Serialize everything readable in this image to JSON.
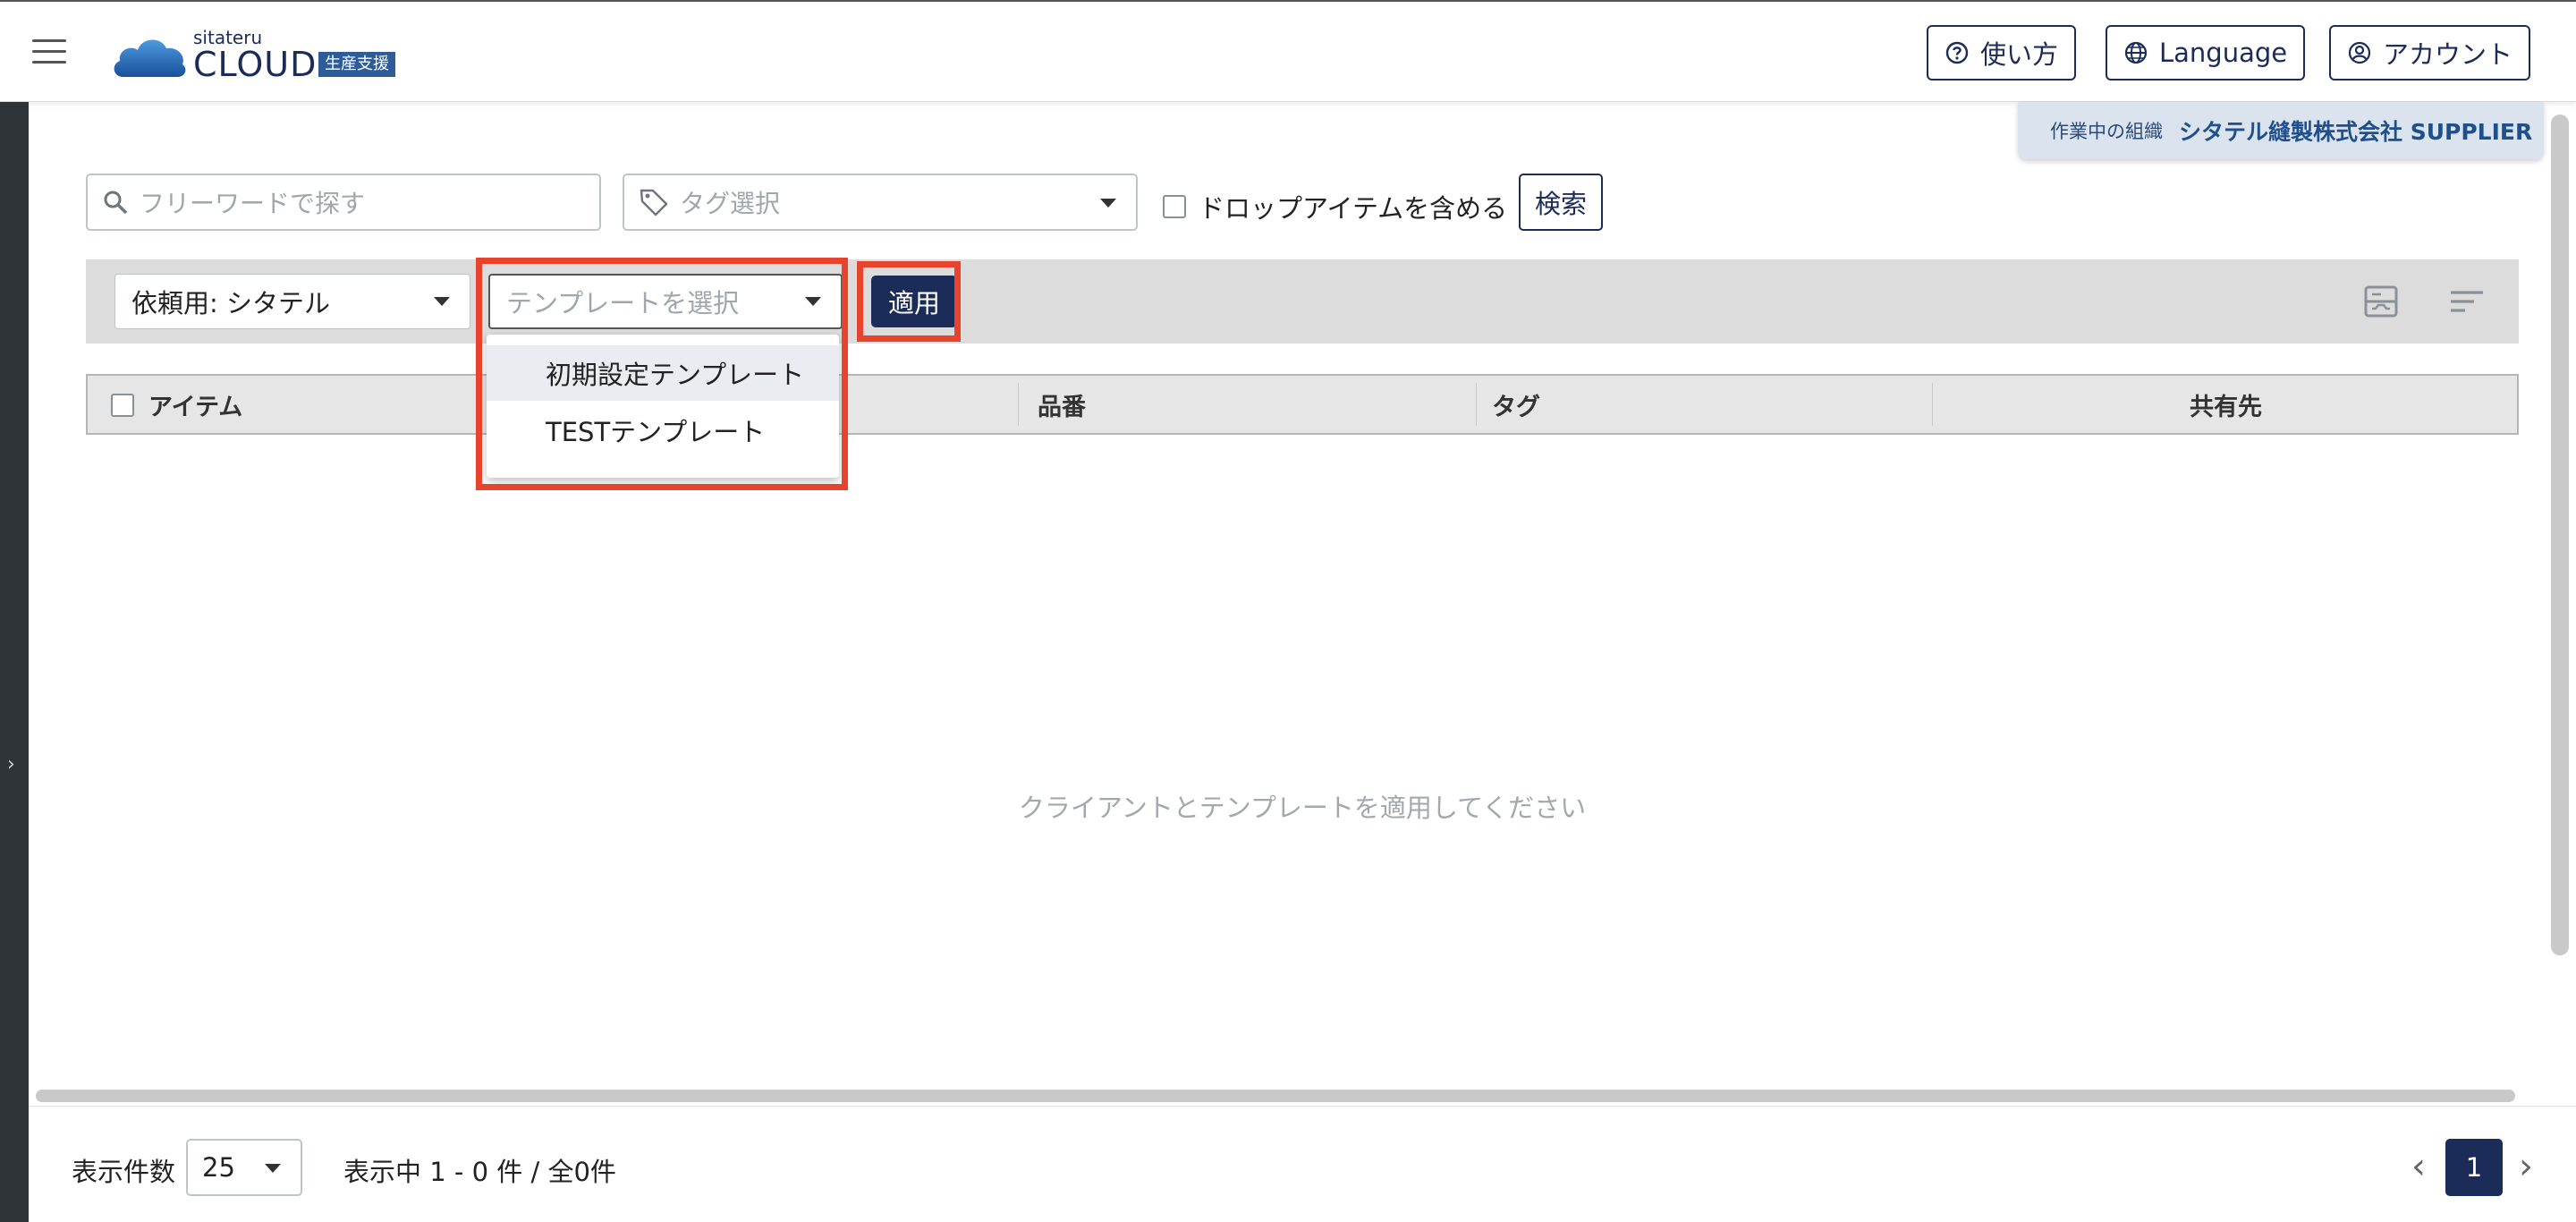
{
  "header": {
    "logo_small": "sitateru",
    "logo_big": "CLOUD",
    "logo_badge": "生産支援",
    "help_label": "使い方",
    "language_label": "Language",
    "account_label": "アカウント"
  },
  "org": {
    "label": "作業中の組織",
    "name": "シタテル縫製株式会社 SUPPLIER"
  },
  "filters": {
    "search_placeholder": "フリーワードで探す",
    "tag_placeholder": "タグ選択",
    "drop_items_label": "ドロップアイテムを含める",
    "search_button": "検索"
  },
  "toolbar": {
    "client_value": "依頼用: シタテル",
    "template_placeholder": "テンプレートを選択",
    "apply_button": "適用"
  },
  "dropdown": {
    "options": [
      "初期設定テンプレート",
      "TESTテンプレート"
    ]
  },
  "table": {
    "columns": [
      "アイテム",
      "品番",
      "タグ",
      "共有先"
    ],
    "empty_message": "クライアントとテンプレートを適用してください"
  },
  "footer": {
    "per_page_label": "表示件数",
    "per_page_value": "25",
    "status": "表示中 1 - 0 件 / 全0件",
    "current_page": "1"
  },
  "colors": {
    "primary": "#1c2c59",
    "highlight": "#e8442d",
    "toolbar_bg": "#dcdcdc"
  }
}
